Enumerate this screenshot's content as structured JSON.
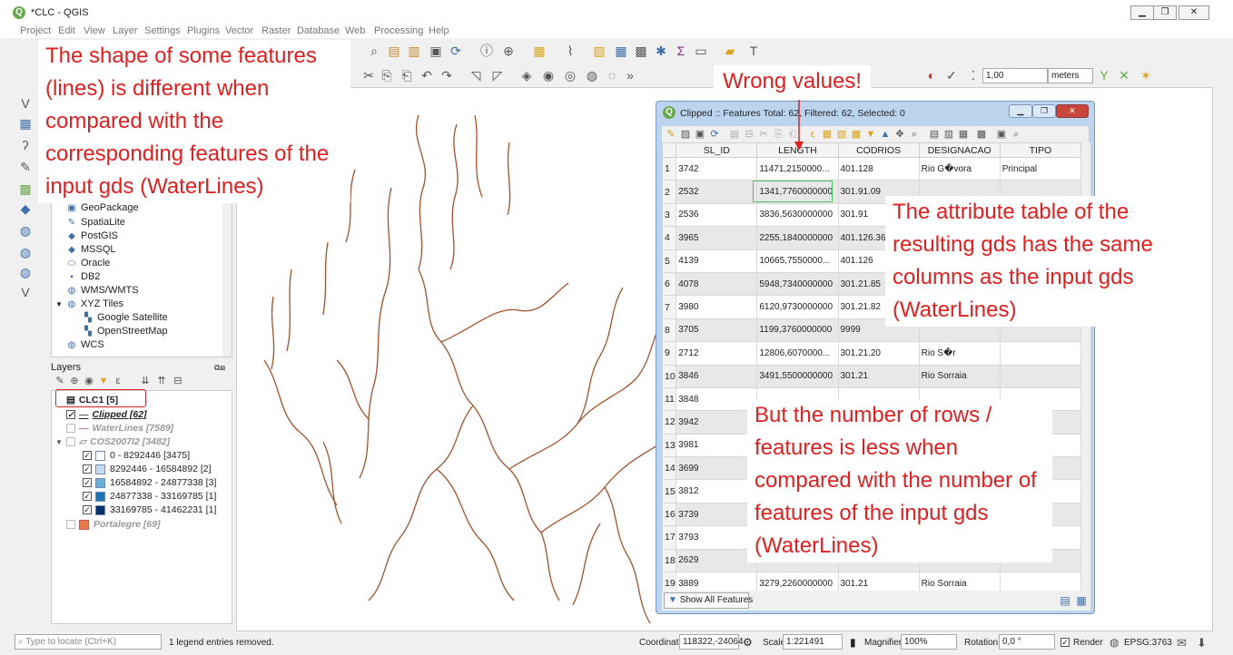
{
  "window": {
    "title": "*CLC - QGIS",
    "minimize": "▁",
    "restore": "❐",
    "close": "✕"
  },
  "menu": [
    "Project",
    "Edit",
    "View",
    "Layer",
    "Settings",
    "Plugins",
    "Vector",
    "Raster",
    "Database",
    "Web",
    "Processing",
    "Help"
  ],
  "toolbar": {
    "snap_tolerance": "1,00",
    "units": "meters"
  },
  "browser": {
    "items": [
      {
        "label": "GeoPackage",
        "icon": "geopackage-icon"
      },
      {
        "label": "SpatiaLite",
        "icon": "spatialite-icon"
      },
      {
        "label": "PostGIS",
        "icon": "postgis-icon"
      },
      {
        "label": "MSSQL",
        "icon": "mssql-icon"
      },
      {
        "label": "Oracle",
        "icon": "oracle-icon"
      },
      {
        "label": "DB2",
        "icon": "db2-icon"
      },
      {
        "label": "WMS/WMTS",
        "icon": "globe-icon"
      },
      {
        "label": "XYZ Tiles",
        "icon": "globe-icon"
      },
      {
        "label": "Google Satellite",
        "icon": "tiles-icon"
      },
      {
        "label": "OpenStreetMap",
        "icon": "tiles-icon"
      },
      {
        "label": "WCS",
        "icon": "globe-icon"
      }
    ]
  },
  "layers": {
    "title": "Layers",
    "items": [
      {
        "label": "CLC1 [5]"
      },
      {
        "label": "Clipped [62]"
      },
      {
        "label": "WaterLines [7589]"
      },
      {
        "label": "COS2007l2 [3482]"
      },
      {
        "label": "0 - 8292446  [3475]",
        "color": "#ffffff"
      },
      {
        "label": "8292446 - 16584892  [2]",
        "color": "#c6dbef"
      },
      {
        "label": "16584892 - 24877338  [3]",
        "color": "#6baed6"
      },
      {
        "label": "24877338 - 33169785  [1]",
        "color": "#2171b5"
      },
      {
        "label": "33169785 - 41462231  [1]",
        "color": "#08306b"
      },
      {
        "label": "Portalegre [69]",
        "color": "#e8774a"
      }
    ]
  },
  "attribute_table": {
    "title": "Clipped :: Features Total: 62, Filtered: 62, Selected: 0",
    "columns": [
      "SL_ID",
      "LENGTH",
      "CODRIOS",
      "DESIGNACAO",
      "TIPO"
    ],
    "rows": [
      [
        "1",
        "3742",
        "11471,2150000...",
        "401.128",
        "Rio G�vora",
        "Principal"
      ],
      [
        "2",
        "2532",
        "1341,7760000000",
        "301.91.09",
        "",
        ""
      ],
      [
        "3",
        "2536",
        "3836,5630000000",
        "301.91",
        "",
        ""
      ],
      [
        "4",
        "3965",
        "2255,1840000000",
        "401.126.36",
        "",
        ""
      ],
      [
        "5",
        "4139",
        "10665,7550000...",
        "401.126",
        "",
        ""
      ],
      [
        "6",
        "4078",
        "5948,7340000000",
        "301.21.85",
        "",
        ""
      ],
      [
        "7",
        "3980",
        "6120,9730000000",
        "301.21.82",
        "",
        ""
      ],
      [
        "8",
        "3705",
        "1199,3760000000",
        "9999",
        "",
        ""
      ],
      [
        "9",
        "2712",
        "12806,6070000...",
        "301.21.20",
        "Rio S�r",
        ""
      ],
      [
        "10",
        "3846",
        "3491,5500000000",
        "301.21",
        "Rio Sorraia",
        ""
      ],
      [
        "11",
        "3848",
        "",
        "",
        "",
        ""
      ],
      [
        "12",
        "3942",
        "",
        "",
        "",
        ""
      ],
      [
        "13",
        "3981",
        "",
        "",
        "",
        ""
      ],
      [
        "14",
        "3699",
        "",
        "",
        "",
        ""
      ],
      [
        "15",
        "3812",
        "",
        "",
        "",
        ""
      ],
      [
        "16",
        "3739",
        "",
        "",
        "",
        ""
      ],
      [
        "17",
        "3793",
        "",
        "",
        "",
        ""
      ],
      [
        "18",
        "2629",
        "",
        "",
        "",
        ""
      ],
      [
        "19",
        "3889",
        "3279,2260000000",
        "301.21",
        "Rio Sorraia",
        ""
      ]
    ],
    "footer_button": "Show All Features"
  },
  "annotations": {
    "shape": "The shape of some features (lines) is different when compared with the corresponding features of the input gds (WaterLines)",
    "wrong_values": "Wrong values!",
    "attr_table": "The attribute table of the resulting gds has the same columns as the input gds (WaterLines)",
    "rows": "But the number of rows / features is less when compared with the number of features of the input gds (WaterLines)"
  },
  "status": {
    "locator_placeholder": "Type to locate (Ctrl+K)",
    "message": "1 legend entries removed.",
    "coordinate_label": "Coordinate",
    "coordinate_value": "118322,-24064",
    "scale_label": "Scale",
    "scale_value": "1:221491",
    "magnifier_label": "Magnifier",
    "magnifier_value": "100%",
    "rotation_label": "Rotation",
    "rotation_value": "0,0 °",
    "render_label": "Render",
    "crs": "EPSG:3763"
  },
  "colors": {
    "annotation": "#e02020",
    "river": "#a0522d"
  }
}
